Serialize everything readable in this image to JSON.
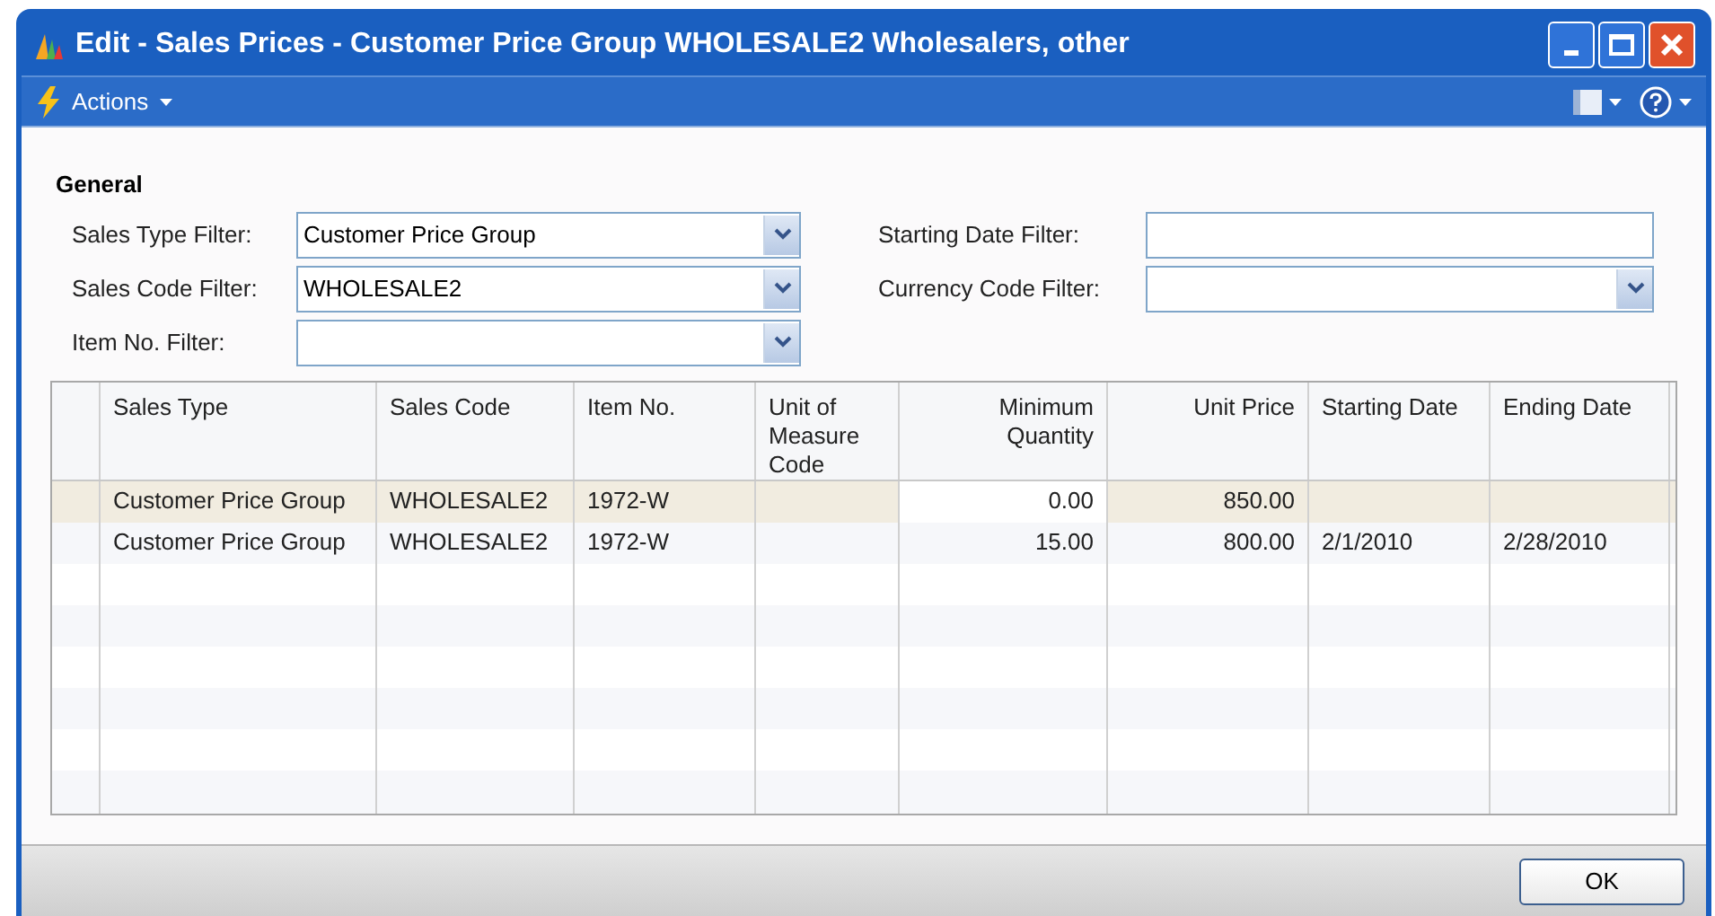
{
  "window": {
    "title": "Edit - Sales Prices - Customer Price Group WHOLESALE2 Wholesalers, other"
  },
  "toolbar": {
    "actions_label": "Actions"
  },
  "general": {
    "title": "General",
    "left_fields": [
      {
        "label": "Sales Type Filter:",
        "value": "Customer Price Group",
        "kind": "dropdown"
      },
      {
        "label": "Sales Code Filter:",
        "value": "WHOLESALE2",
        "kind": "dropdown"
      },
      {
        "label": "Item No. Filter:",
        "kind": "dropdown"
      }
    ],
    "right_fields": [
      {
        "label": "Starting Date Filter:",
        "kind": "text"
      },
      {
        "label": "Currency Code Filter:",
        "kind": "dropdown"
      }
    ]
  },
  "table": {
    "columns": [
      "Sales Type",
      "Sales Code",
      "Item No.",
      "Unit of Measure Code",
      "Minimum Quantity",
      "Unit Price",
      "Starting Date",
      "Ending Date"
    ],
    "rows": [
      {
        "selected": true,
        "cells": [
          {
            "text": "Customer Price Group",
            "focused": false
          },
          {
            "text": "WHOLESALE2",
            "focused": false
          },
          {
            "text": "1972-W",
            "focused": false
          },
          {
            "focused": false
          },
          {
            "text": "0.00",
            "focused": true
          },
          {
            "text": "850.00",
            "focused": false
          },
          {
            "focused": false
          },
          {
            "focused": false
          }
        ]
      },
      {
        "selected": false,
        "cells": [
          {
            "text": "Customer Price Group",
            "focused": false
          },
          {
            "text": "WHOLESALE2",
            "focused": false
          },
          {
            "text": "1972-W",
            "focused": false
          },
          {
            "focused": false
          },
          {
            "text": "15.00",
            "focused": false
          },
          {
            "text": "800.00",
            "focused": false
          },
          {
            "text": "2/1/2010",
            "focused": false
          },
          {
            "text": "2/28/2010",
            "focused": false
          }
        ]
      }
    ]
  },
  "buttons": [
    "OK"
  ]
}
